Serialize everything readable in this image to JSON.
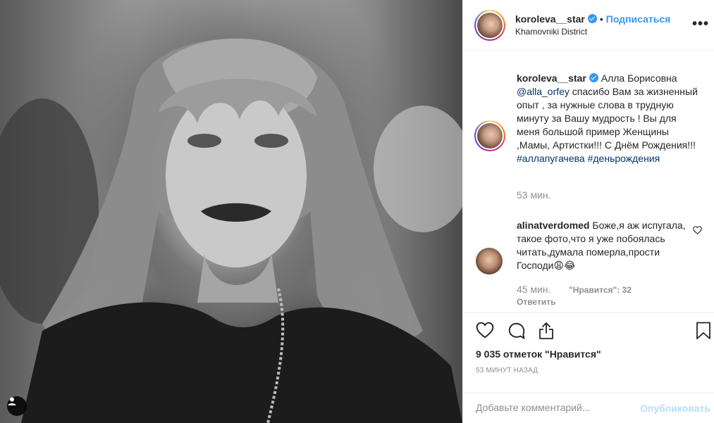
{
  "post": {
    "username": "koroleva__star",
    "follow_label": "Подписаться",
    "location": "Khamovniki District",
    "more_label": "•••"
  },
  "caption": {
    "username": "koroleva__star",
    "text_1": "Алла Борисовна",
    "mention": "@alla_orfey",
    "text_2": " спасибо Вам за жизненный опыт , за нужные слова в трудную минуту за Вашу мудрость ! Вы для меня большой пример Женщины ,Мамы, Артистки!!! С Днём Рождения!!! ",
    "hashtag_1": "#аллапугачева",
    "hashtag_2": "#деньрождения",
    "time": "53 мин."
  },
  "comments": [
    {
      "username": "alinatverdomed",
      "text": "Боже,я аж испугала, такое фото,что я уже побоялась читать,думала померла,прости Господи😩😂",
      "time": "45 мин.",
      "likes": "\"Нравится\": 32",
      "reply": "Ответить"
    }
  ],
  "actions": {
    "likes_count": "9 035 отметок \"Нравится\"",
    "timestamp": "53 МИНУТ НАЗАД",
    "comment_placeholder": "Добавьте комментарий...",
    "publish_label": "Опубликовать"
  },
  "colors": {
    "accent": "#3897f0",
    "publish_disabled": "#b2dffc",
    "muted": "#8e8e8e",
    "link": "#003569"
  },
  "icons": [
    "heart-icon",
    "comment-icon",
    "share-icon",
    "bookmark-icon",
    "user-tag-icon",
    "verified-icon",
    "more-icon"
  ]
}
